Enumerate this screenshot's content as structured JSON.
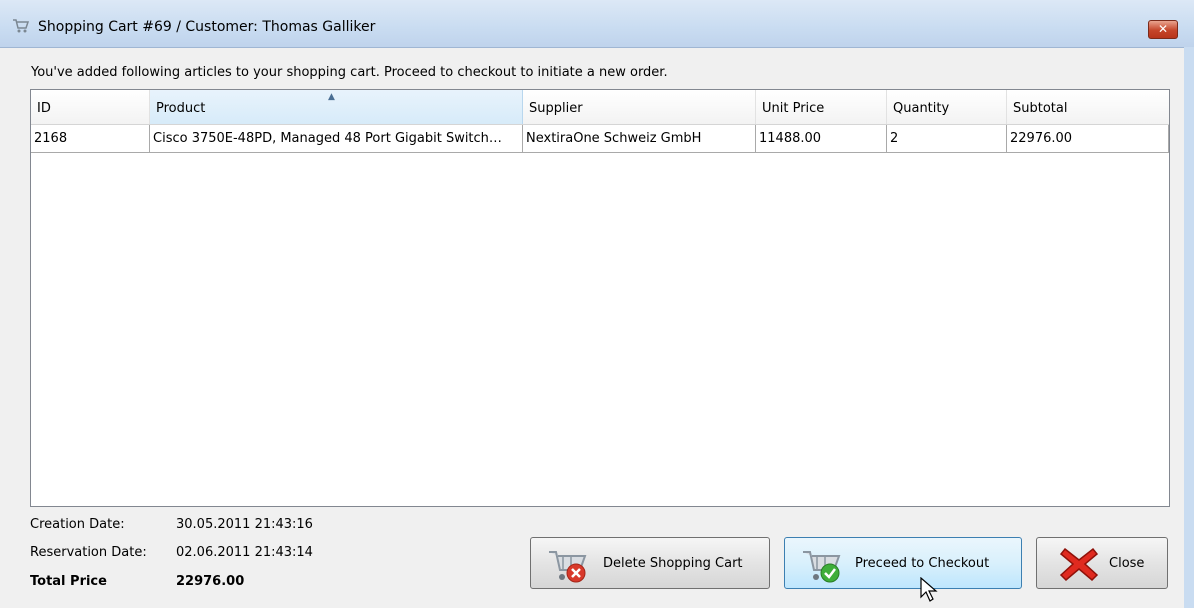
{
  "window": {
    "title": "Shopping Cart #69 / Customer: Thomas Galliker",
    "close_icon": "close-icon",
    "title_icon": "shopping-cart-icon"
  },
  "intro_text": "You've added following articles to your shopping cart. Proceed to checkout to initiate a new order.",
  "table": {
    "columns": [
      "ID",
      "Product",
      "Supplier",
      "Unit Price",
      "Quantity",
      "Subtotal"
    ],
    "sorted_column": "Product",
    "rows": [
      {
        "id": "2168",
        "product": "Cisco 3750E-48PD, Managed 48 Port Gigabit Switch…",
        "supplier": "NextiraOne Schweiz GmbH",
        "unit_price": "11488.00",
        "quantity": "2",
        "subtotal": "22976.00"
      }
    ]
  },
  "summary": {
    "creation_label": "Creation Date:",
    "creation_value": "30.05.2011 21:43:16",
    "reservation_label": "Reservation Date:",
    "reservation_value": "02.06.2011 21:43:14",
    "total_label": "Total Price",
    "total_value": "22976.00"
  },
  "buttons": {
    "delete": "Delete Shopping Cart",
    "checkout": "Preceed to Checkout",
    "close": "Close"
  },
  "colors": {
    "titlebar": "#c9dcf1",
    "close_red": "#c5452a",
    "hover_blue": "#bee6fd"
  }
}
